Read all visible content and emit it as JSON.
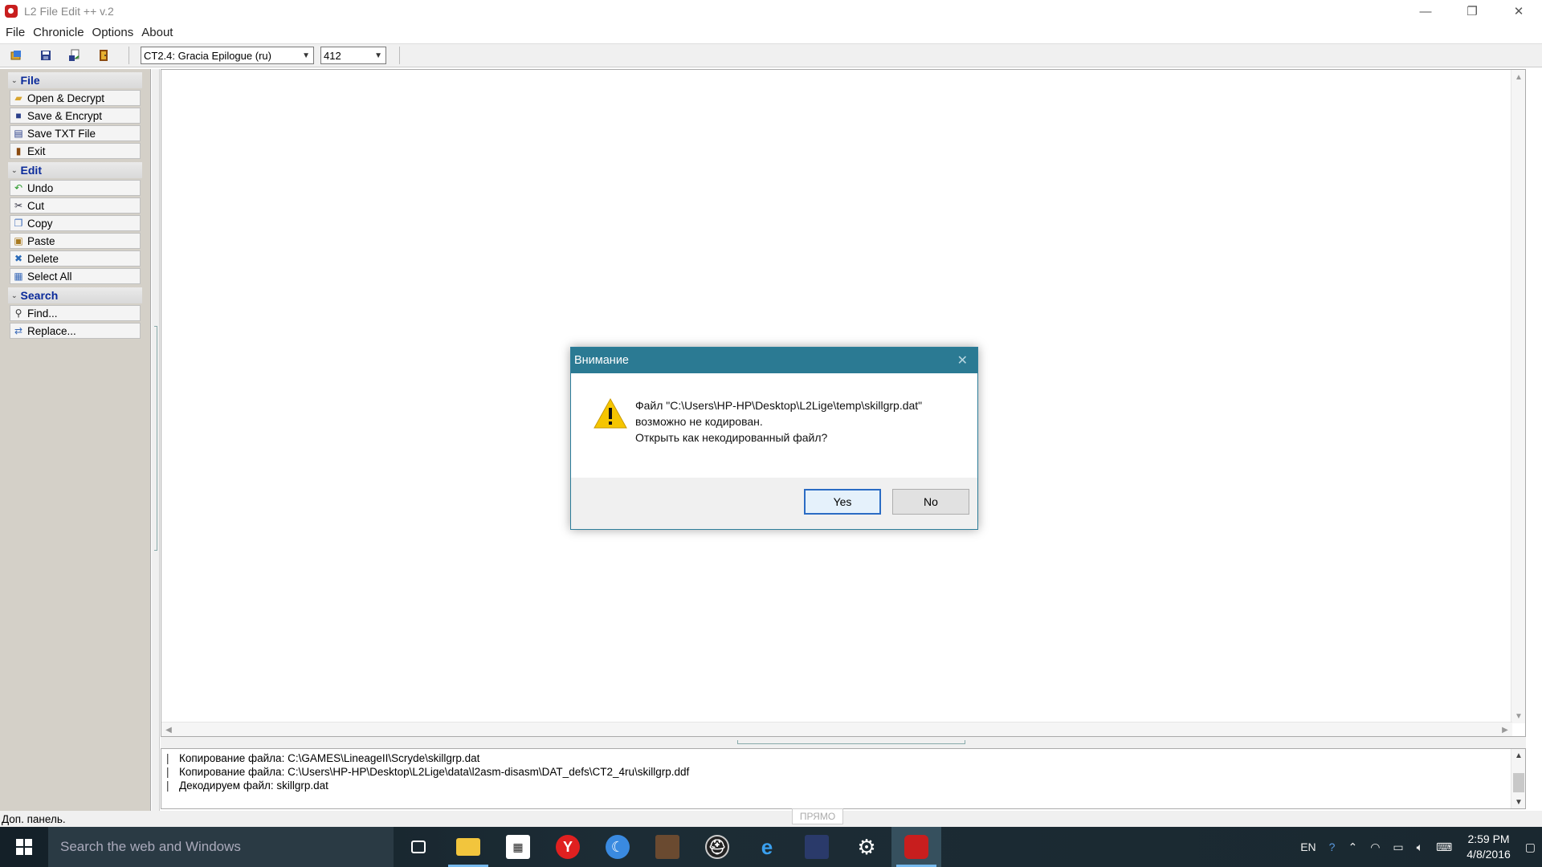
{
  "window": {
    "title": "L2 File Edit ++ v.2",
    "minimize": "—",
    "maximize": "❐",
    "close": "✕"
  },
  "menu": [
    "File",
    "Chronicle",
    "Options",
    "About"
  ],
  "toolbar": {
    "chronicle": "CT2.4: Gracia Epilogue (ru)",
    "version": "412"
  },
  "panel": {
    "sections": [
      {
        "title": "File",
        "items": [
          "Open & Decrypt",
          "Save & Encrypt",
          "Save TXT File",
          "Exit"
        ]
      },
      {
        "title": "Edit",
        "items": [
          "Undo",
          "Cut",
          "Copy",
          "Paste",
          "Delete",
          "Select All"
        ]
      },
      {
        "title": "Search",
        "items": [
          "Find...",
          "Replace..."
        ]
      }
    ]
  },
  "log": [
    "Копирование файла: C:\\GAMES\\LineageII\\Scryde\\skillgrp.dat",
    "Копирование файла: C:\\Users\\HP-HP\\Desktop\\L2Lige\\data\\l2asm-disasm\\DAT_defs\\CT2_4ru\\skillgrp.ddf",
    "Декодируем файл: skillgrp.dat"
  ],
  "status": {
    "text": "Доп. панель.",
    "ime": "ПРЯМО"
  },
  "dialog": {
    "title": "Внимание",
    "line1": "Файл \"C:\\Users\\HP-HP\\Desktop\\L2Lige\\temp\\skillgrp.dat\"",
    "line2": "возможно не кодирован.",
    "line3": "Открыть как некодированный файл?",
    "yes": "Yes",
    "no": "No"
  },
  "taskbar": {
    "search_placeholder": "Search the web and Windows",
    "lang": "EN",
    "time": "2:59 PM",
    "date": "4/8/2016"
  }
}
